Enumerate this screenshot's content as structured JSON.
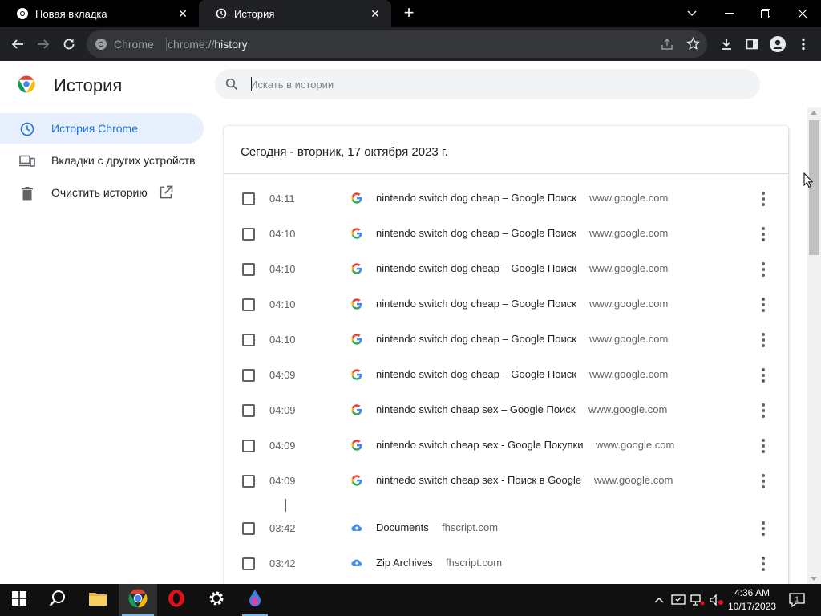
{
  "browser": {
    "tabs": [
      {
        "label": "Новая вкладка",
        "active": false,
        "icon": "chrome-icon"
      },
      {
        "label": "История",
        "active": true,
        "icon": "history-icon"
      }
    ],
    "omnibox": {
      "site_label": "Chrome",
      "url_prefix": "chrome://",
      "url_path": "history"
    }
  },
  "page": {
    "title": "История",
    "search": {
      "placeholder": "Искать в истории",
      "value": ""
    },
    "sidebar": {
      "items": [
        {
          "label": "История Chrome",
          "icon": "clock-icon",
          "active": true
        },
        {
          "label": "Вкладки с других устройств",
          "icon": "devices-icon",
          "active": false
        },
        {
          "label": "Очистить историю",
          "icon": "trash-icon",
          "active": false,
          "trailing_icon": "open-in-new-icon"
        }
      ]
    },
    "history": {
      "date_header": "Сегодня - вторник, 17 октября 2023 г.",
      "entries": [
        {
          "time": "04:11",
          "title": "nintendo switch dog cheap – Google Поиск",
          "domain": "www.google.com",
          "favicon": "google-icon"
        },
        {
          "time": "04:10",
          "title": "nintendo switch dog cheap – Google Поиск",
          "domain": "www.google.com",
          "favicon": "google-icon"
        },
        {
          "time": "04:10",
          "title": "nintendo switch dog cheap – Google Поиск",
          "domain": "www.google.com",
          "favicon": "google-icon"
        },
        {
          "time": "04:10",
          "title": "nintendo switch dog cheap – Google Поиск",
          "domain": "www.google.com",
          "favicon": "google-icon"
        },
        {
          "time": "04:10",
          "title": "nintendo switch dog cheap – Google Поиск",
          "domain": "www.google.com",
          "favicon": "google-icon"
        },
        {
          "time": "04:09",
          "title": "nintendo switch dog cheap – Google Поиск",
          "domain": "www.google.com",
          "favicon": "google-icon"
        },
        {
          "time": "04:09",
          "title": "nintendo switch cheap sex – Google Поиск",
          "domain": "www.google.com",
          "favicon": "google-icon"
        },
        {
          "time": "04:09",
          "title": "nintendo switch cheap sex - Google Покупки",
          "domain": "www.google.com",
          "favicon": "google-icon"
        },
        {
          "time": "04:09",
          "title": "nintnedo switch cheap sex - Поиск в Google",
          "domain": "www.google.com",
          "favicon": "google-icon"
        },
        {
          "time": "03:42",
          "title": "Documents",
          "domain": "fhscript.com",
          "favicon": "cloud-icon"
        },
        {
          "time": "03:42",
          "title": "Zip Archives",
          "domain": "fhscript.com",
          "favicon": "cloud-icon"
        }
      ]
    }
  },
  "taskbar": {
    "apps": [
      "start-icon",
      "search-icon",
      "file-explorer-icon",
      "chrome-icon",
      "opera-icon",
      "settings-icon",
      "paint-icon"
    ],
    "clock": {
      "time": "4:36 AM",
      "date": "10/17/2023"
    }
  },
  "colors": {
    "accent": "#1a73e8",
    "active_nav_bg": "#e8f0fe",
    "toolbar_bg": "#202124",
    "titlebar_bg": "#000000"
  }
}
